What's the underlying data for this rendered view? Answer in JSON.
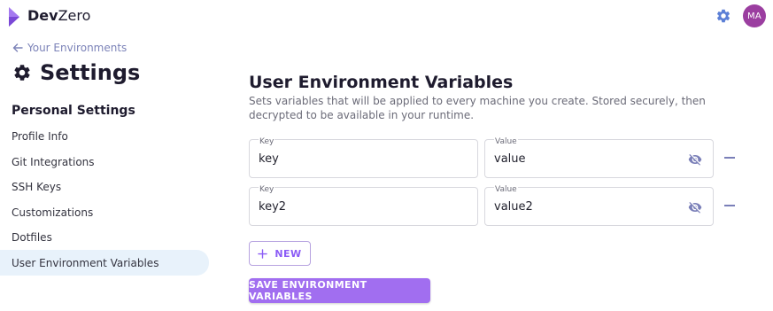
{
  "header": {
    "brand_primary": "Dev",
    "brand_secondary": "Zero",
    "avatar_initials": "MA"
  },
  "sidebar": {
    "back_label": "Your Environments",
    "page_title": "Settings",
    "section_title": "Personal Settings",
    "items": [
      {
        "label": "Profile Info"
      },
      {
        "label": "Git Integrations"
      },
      {
        "label": "SSH Keys"
      },
      {
        "label": "Customizations"
      },
      {
        "label": "Dotfiles"
      },
      {
        "label": "User Environment Variables"
      }
    ],
    "active_item": "User Environment Variables"
  },
  "main": {
    "title": "User Environment Variables",
    "description": "Sets variables that will be applied to every machine you create. Stored securely, then decrypted to be available in your runtime.",
    "variables": [
      {
        "key_label": "Key",
        "key_value": "key",
        "value_label": "Value",
        "value_value": "value"
      },
      {
        "key_label": "Key",
        "key_value": "key2",
        "value_label": "Value",
        "value_value": "value2"
      }
    ],
    "new_button_label": "NEW",
    "save_button_label": "SAVE ENVIRONMENT VARIABLES"
  },
  "icons": {
    "logo": "devzero-logo",
    "settings": "gear-icon",
    "back": "arrow-left-icon",
    "visibility": "eye-off-icon",
    "remove": "minus-icon",
    "add": "plus-icon"
  },
  "colors": {
    "accent": "#8b5cf6",
    "save_button": "#a16ef0",
    "avatar": "#9b3ea0",
    "active_nav": "#e8f2fb",
    "link": "#7c83b8"
  }
}
